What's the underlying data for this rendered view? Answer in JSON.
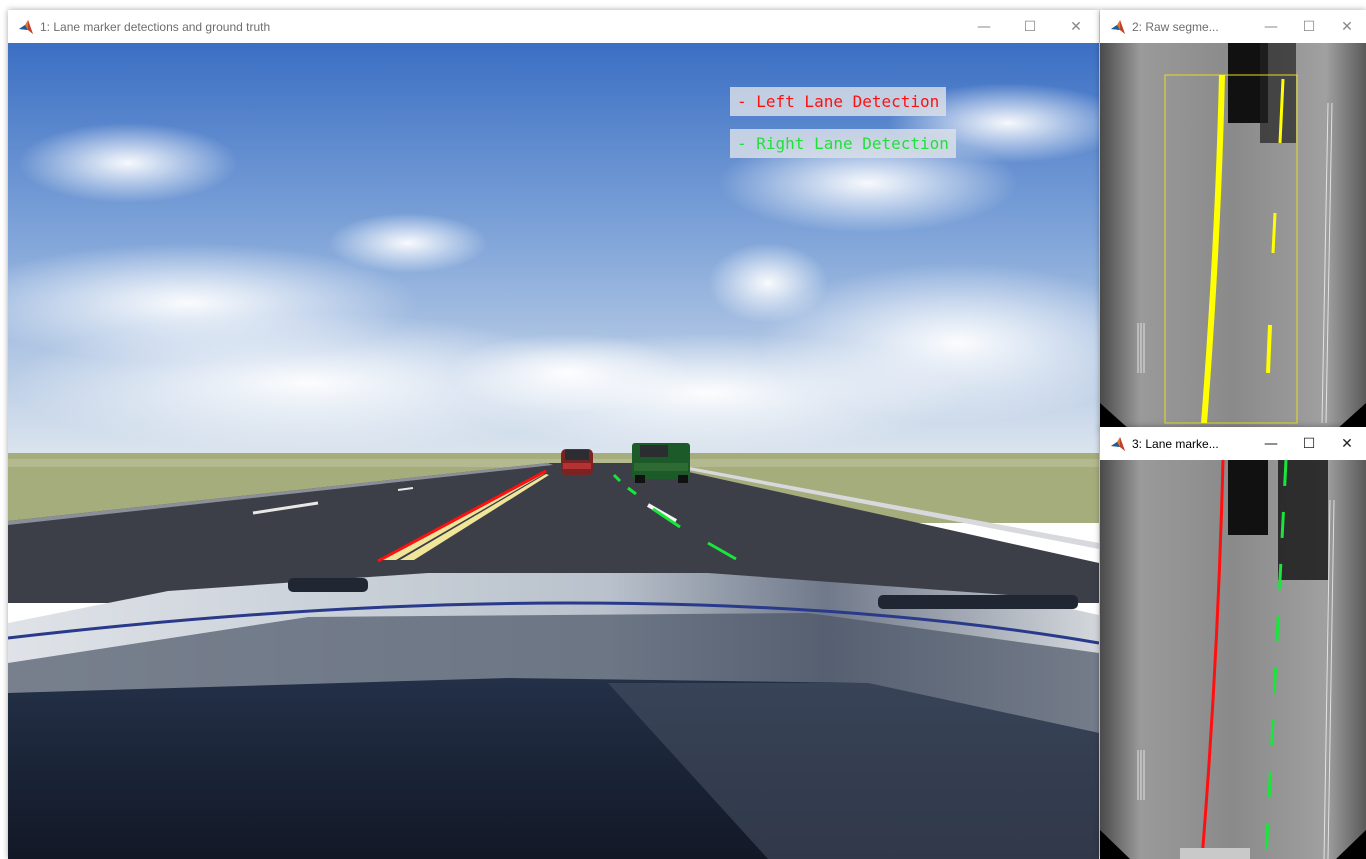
{
  "windows": [
    {
      "id": "main",
      "title": "1: Lane marker detections and ground truth",
      "active": false
    },
    {
      "id": "raw",
      "title": "2: Raw segme...",
      "active": false
    },
    {
      "id": "lane",
      "title": "3: Lane marke...",
      "active": true
    }
  ],
  "legend": {
    "left": {
      "label": "- Left Lane Detection",
      "color": "#ff1010"
    },
    "right": {
      "label": "- Right Lane Detection",
      "color": "#22e03a"
    }
  },
  "controls": {
    "minimize": "—",
    "maximize": "☐",
    "close": "✕"
  },
  "colors": {
    "left_detection": "#ff1010",
    "right_detection": "#19e53a",
    "segmentation": "#ffff00",
    "roi_box": "#e6dd20"
  }
}
